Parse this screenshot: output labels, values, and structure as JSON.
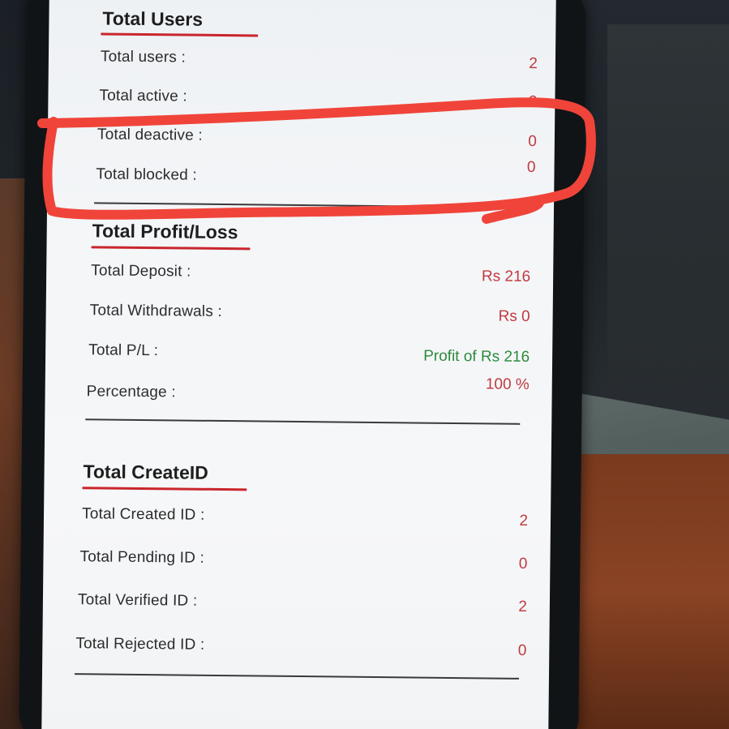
{
  "users": {
    "title": "Total Users",
    "rows": [
      {
        "label": "Total users :",
        "value": "2"
      },
      {
        "label": "Total active :",
        "value": "2"
      },
      {
        "label": "Total deactive :",
        "value": "0"
      },
      {
        "label": "Total blocked :",
        "value": "0"
      }
    ]
  },
  "profit_loss": {
    "title": "Total Profit/Loss",
    "rows": [
      {
        "label": "Total Deposit :",
        "value": "Rs 216"
      },
      {
        "label": "Total Withdrawals :",
        "value": "Rs 0"
      },
      {
        "label": "Total P/L :",
        "value": "Profit of Rs 216"
      },
      {
        "label": "Percentage :",
        "value": "100 %"
      }
    ]
  },
  "create_id": {
    "title": "Total CreateID",
    "rows": [
      {
        "label": "Total Created ID :",
        "value": "2"
      },
      {
        "label": "Total Pending ID :",
        "value": "0"
      },
      {
        "label": "Total Verified  ID :",
        "value": "2"
      },
      {
        "label": "Total Rejected  ID :",
        "value": "0"
      }
    ]
  },
  "colors": {
    "accent": "#c9262c",
    "value_red": "#c0393f",
    "value_green": "#2a8a3c",
    "annotation": "#f0443a"
  }
}
